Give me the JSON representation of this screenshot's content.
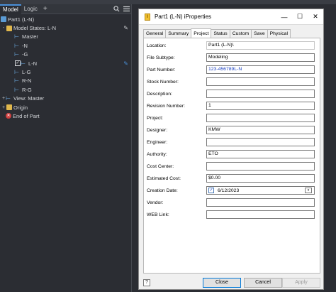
{
  "browser": {
    "tabs": [
      {
        "label": "Model"
      },
      {
        "label": "Logic"
      }
    ],
    "add_tab": "+",
    "search_icon": "search-icon",
    "menu_icon": "menu-icon",
    "tree": [
      {
        "label": "Part1 (L-N)",
        "level": 0,
        "icon": "part"
      },
      {
        "label": "Model States: L-N",
        "level": 1,
        "icon": "folder",
        "expander": "-"
      },
      {
        "label": "Master",
        "level": 2,
        "icon": "state"
      },
      {
        "label": "-N",
        "level": 2,
        "icon": "state"
      },
      {
        "label": "-G",
        "level": 2,
        "icon": "state"
      },
      {
        "label": "L-N",
        "level": 2,
        "icon": "state",
        "checked": true
      },
      {
        "label": "L-G",
        "level": 2,
        "icon": "state"
      },
      {
        "label": "R-N",
        "level": 2,
        "icon": "state"
      },
      {
        "label": "R-G",
        "level": 2,
        "icon": "state"
      },
      {
        "label": "View: Master",
        "level": 0,
        "icon": "state",
        "expander": "+"
      },
      {
        "label": "Origin",
        "level": 0,
        "icon": "folder",
        "expander": "+"
      },
      {
        "label": "End of Part",
        "level": 0,
        "icon": "end"
      }
    ]
  },
  "dialog": {
    "title": "Part1 (L-N) iProperties",
    "tabs": [
      "General",
      "Summary",
      "Project",
      "Status",
      "Custom",
      "Save",
      "Physical"
    ],
    "active_tab": "Project",
    "fields": [
      {
        "label": "Location:",
        "value": "Part1 (L-N)\\",
        "style": "plain"
      },
      {
        "label": "File Subtype:",
        "value": "Modeling",
        "style": "box"
      },
      {
        "label": "Part Number:",
        "value": "123-456789L-N",
        "style": "blue"
      },
      {
        "label": "Stock Number:",
        "value": "",
        "style": "box"
      },
      {
        "label": "Description:",
        "value": "",
        "style": "box"
      },
      {
        "label": "Revision Number:",
        "value": "1",
        "style": "box"
      },
      {
        "label": "Project:",
        "value": "",
        "style": "box"
      },
      {
        "label": "Designer:",
        "value": "KMW",
        "style": "box"
      },
      {
        "label": "Engineer:",
        "value": "",
        "style": "box"
      },
      {
        "label": "Authority:",
        "value": "ETO",
        "style": "box"
      },
      {
        "label": "Cost Center:",
        "value": "",
        "style": "box"
      },
      {
        "label": "Estimated Cost:",
        "value": "$0.00",
        "style": "box"
      },
      {
        "label": "Creation Date:",
        "value": "6/12/2023",
        "style": "date"
      },
      {
        "label": "Vendor:",
        "value": "",
        "style": "box"
      },
      {
        "label": "WEB Link:",
        "value": "",
        "style": "box"
      }
    ],
    "help_label": "?",
    "buttons": {
      "close": "Close",
      "cancel": "Cancel",
      "apply": "Apply"
    }
  },
  "colors": {
    "accent": "#4a90d9",
    "panel_bg": "#2b2d33",
    "dialog_bg": "#f0f0f0"
  }
}
